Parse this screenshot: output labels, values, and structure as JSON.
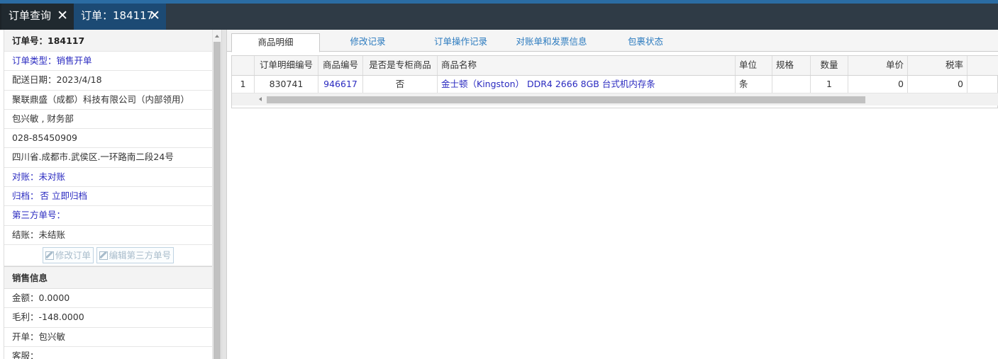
{
  "tabs": [
    {
      "label": "订单查询",
      "close": "✕"
    },
    {
      "label": "订单：184117",
      "close": "✕"
    }
  ],
  "order": {
    "number": "订单号：184117",
    "type_label": "订单类型：",
    "type_value": "销售开单",
    "delivery_date": "配送日期：2023/4/18",
    "company": "聚联鼎盛（成都）科技有限公司（内部领用）",
    "contact": "包兴敏 , 财务部",
    "phone": "028-85450909",
    "address": "四川省.成都市.武侯区.一环路南二段24号",
    "reconcile_label": "对账：",
    "reconcile_value": "未对账",
    "archive_label": "归档：",
    "archive_value": "否 立即归档",
    "third_party_label": "第三方单号：",
    "settle_label": "结账：",
    "settle_value": "未结账",
    "edit_order_btn": "修改订单",
    "edit_third_party_btn": "编辑第三方单号"
  },
  "sales": {
    "header": "销售信息",
    "amount": "金额：0.0000",
    "gross_profit": "毛利：-148.0000",
    "issuer": "开单：包兴敏",
    "customer": "客服："
  },
  "subtabs": [
    "商品明细",
    "修改记录",
    "订单操作记录",
    "对账单和发票信息",
    "包裹状态"
  ],
  "grid": {
    "columns": [
      "",
      "订单明细编号",
      "商品编号",
      "是否是专柜商品",
      "商品名称",
      "单位",
      "规格",
      "数量",
      "单价",
      "税率"
    ],
    "rows": [
      {
        "index": "1",
        "detail_id": "830741",
        "product_id": "946617",
        "is_counter": "否",
        "name": "金士顿（Kingston） DDR4 2666 8GB 台式机内存条",
        "unit": "条",
        "spec": "",
        "qty": "1",
        "price": "0",
        "tax": "0"
      }
    ]
  }
}
